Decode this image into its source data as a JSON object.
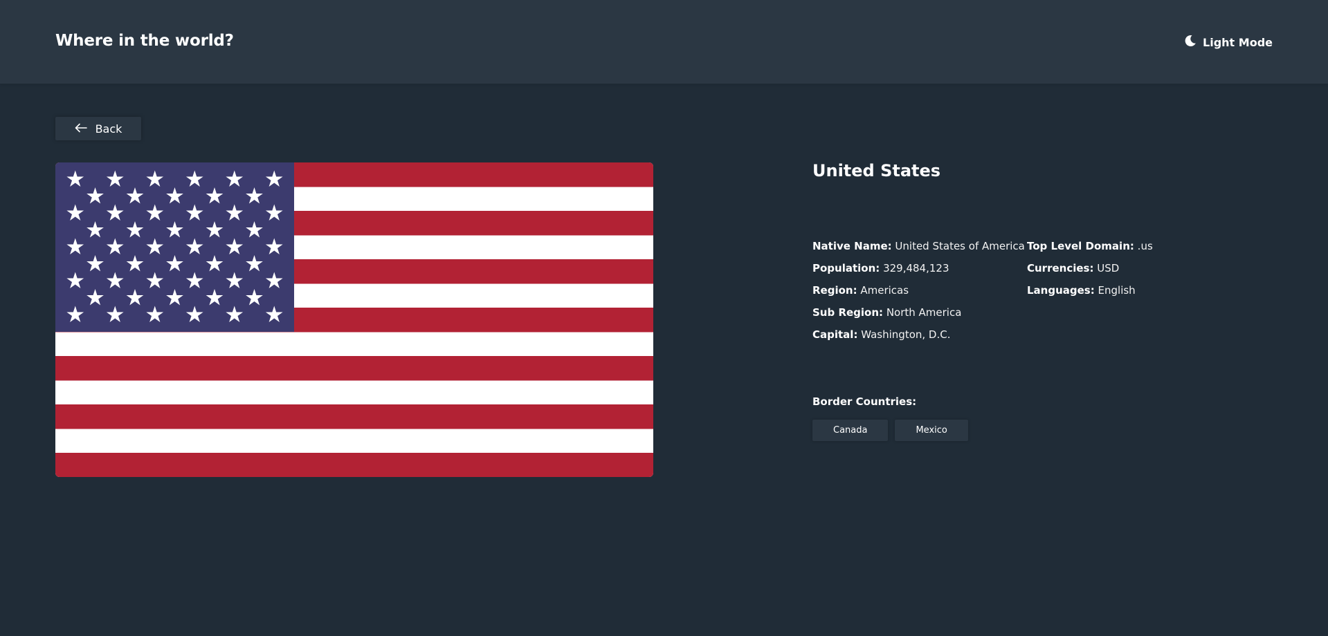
{
  "header": {
    "title": "Where in the world?",
    "theme_toggle_label": "Light Mode",
    "theme_icon": "moon-icon"
  },
  "back_button": {
    "label": "Back",
    "icon": "arrow-left-icon"
  },
  "country": {
    "name": "United States",
    "flag": {
      "description_icon": "us-flag",
      "colors": {
        "red": "#b22234",
        "white": "#ffffff",
        "blue": "#3c3b6e"
      }
    },
    "left_info": [
      {
        "key": "Native Name:",
        "value": "United States of America"
      },
      {
        "key": "Population:",
        "value": "329,484,123"
      },
      {
        "key": "Region:",
        "value": "Americas"
      },
      {
        "key": "Sub Region:",
        "value": "North America"
      },
      {
        "key": "Capital:",
        "value": "Washington, D.C."
      }
    ],
    "right_info": [
      {
        "key": "Top Level Domain:",
        "value": ".us"
      },
      {
        "key": "Currencies:",
        "value": "USD"
      },
      {
        "key": "Languages:",
        "value": "English"
      }
    ],
    "border_countries_label": "Border Countries:",
    "border_countries": [
      "Canada",
      "Mexico"
    ]
  },
  "theme": {
    "background": "#202c37",
    "element": "#2b3743",
    "text": "#ffffff"
  }
}
